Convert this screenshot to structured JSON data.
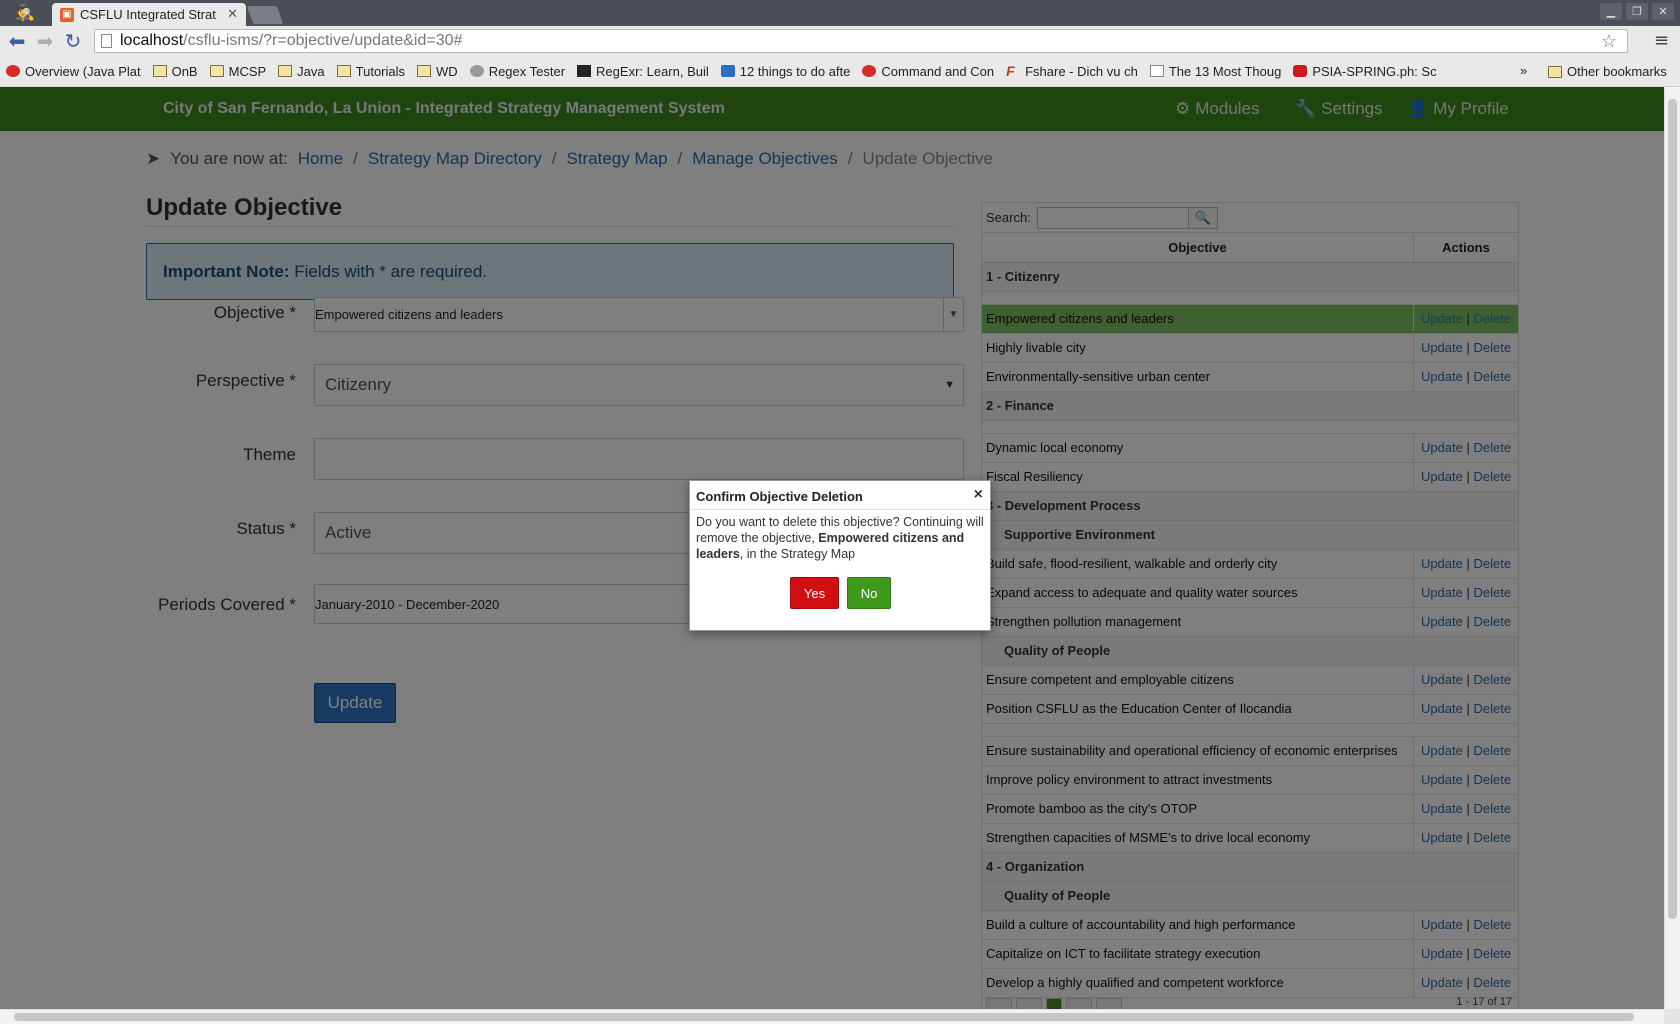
{
  "browser": {
    "tab_title": "CSFLU Integrated Strat",
    "url_host": "localhost",
    "url_path": "/csflu-isms/?r=objective/update&id=30#",
    "bookmarks": [
      {
        "label": "Overview (Java Plat",
        "icon": "red"
      },
      {
        "label": "OnB",
        "icon": "folder"
      },
      {
        "label": "MCSP",
        "icon": "folder"
      },
      {
        "label": "Java",
        "icon": "folder"
      },
      {
        "label": "Tutorials",
        "icon": "folder"
      },
      {
        "label": "WD",
        "icon": "folder"
      },
      {
        "label": "Regex Tester",
        "icon": "gear"
      },
      {
        "label": "RegExr: Learn, Buil",
        "icon": "blk"
      },
      {
        "label": "12 things to do afte",
        "icon": "blue"
      },
      {
        "label": "Command and Con",
        "icon": "red"
      },
      {
        "label": "Fshare - Dich vu ch",
        "icon": "f"
      },
      {
        "label": "The 13 Most Thoug",
        "icon": "doc"
      },
      {
        "label": "PSIA-SPRING.ph: Sc",
        "icon": "yt"
      }
    ],
    "bookmarks_more": "»",
    "other_bookmarks": "Other bookmarks"
  },
  "navbar": {
    "brand": "City of San Fernando, La Union - Integrated Strategy Management System",
    "modules": "Modules",
    "settings": "Settings",
    "profile": "My Profile"
  },
  "breadcrumb": {
    "prefix": "You are now at:",
    "home": "Home",
    "directory": "Strategy Map Directory",
    "map": "Strategy Map",
    "manage": "Manage Objectives",
    "current": "Update Objective",
    "sep": "/"
  },
  "form": {
    "title": "Update Objective",
    "note_bold": "Important Note:",
    "note_text": " Fields with * are required.",
    "objective_label": "Objective *",
    "objective_value": "Empowered citizens and leaders",
    "perspective_label": "Perspective *",
    "perspective_value": "Citizenry",
    "theme_label": "Theme",
    "theme_value": "",
    "status_label": "Status *",
    "status_value": "Active",
    "periods_label": "Periods Covered *",
    "periods_value": "January-2010 - December-2020",
    "update_button": "Update"
  },
  "table": {
    "search_label": "Search:",
    "col_objective": "Objective",
    "col_actions": "Actions",
    "update": "Update",
    "delete": "Delete",
    "bar": " | ",
    "groups": {
      "g1": "1 - Citizenry",
      "g2": "2 - Finance",
      "g3": "3 - Development Process",
      "g3a": "Supportive Environment",
      "g3b": "Quality of People",
      "g4": "4 - Organization",
      "g4a": "Quality of People"
    },
    "rows": {
      "r1": "Empowered citizens and leaders",
      "r2": "Highly livable city",
      "r3": "Environmentally-sensitive urban center",
      "r4": "Dynamic local economy",
      "r5": "Fiscal Resiliency",
      "r6": "Build safe, flood-resilient, walkable and orderly city",
      "r7": "Expand access to adequate and quality water sources",
      "r8": "Strengthen pollution management",
      "r9": "Ensure competent and employable citizens",
      "r10": "Position CSFLU as the Education Center of Ilocandia",
      "r11": "Ensure sustainability and operational efficiency of economic enterprises",
      "r12": "Improve policy environment to attract investments",
      "r13": "Promote bamboo as the city's OTOP",
      "r14": "Strengthen capacities of MSME's to drive local economy",
      "r15": "Build a culture of accountability and high performance",
      "r16": "Capitalize on ICT to facilitate strategy execution",
      "r17": "Develop a highly qualified and competent workforce"
    },
    "pager_count": "1 - 17 of 17"
  },
  "modal": {
    "title": "Confirm Objective Deletion",
    "text_1": "Do you want to delete this objective? Continuing will remove the objective, ",
    "text_bold": "Empowered citizens and leaders",
    "text_2": ", in the Strategy Map",
    "yes": "Yes",
    "no": "No"
  }
}
